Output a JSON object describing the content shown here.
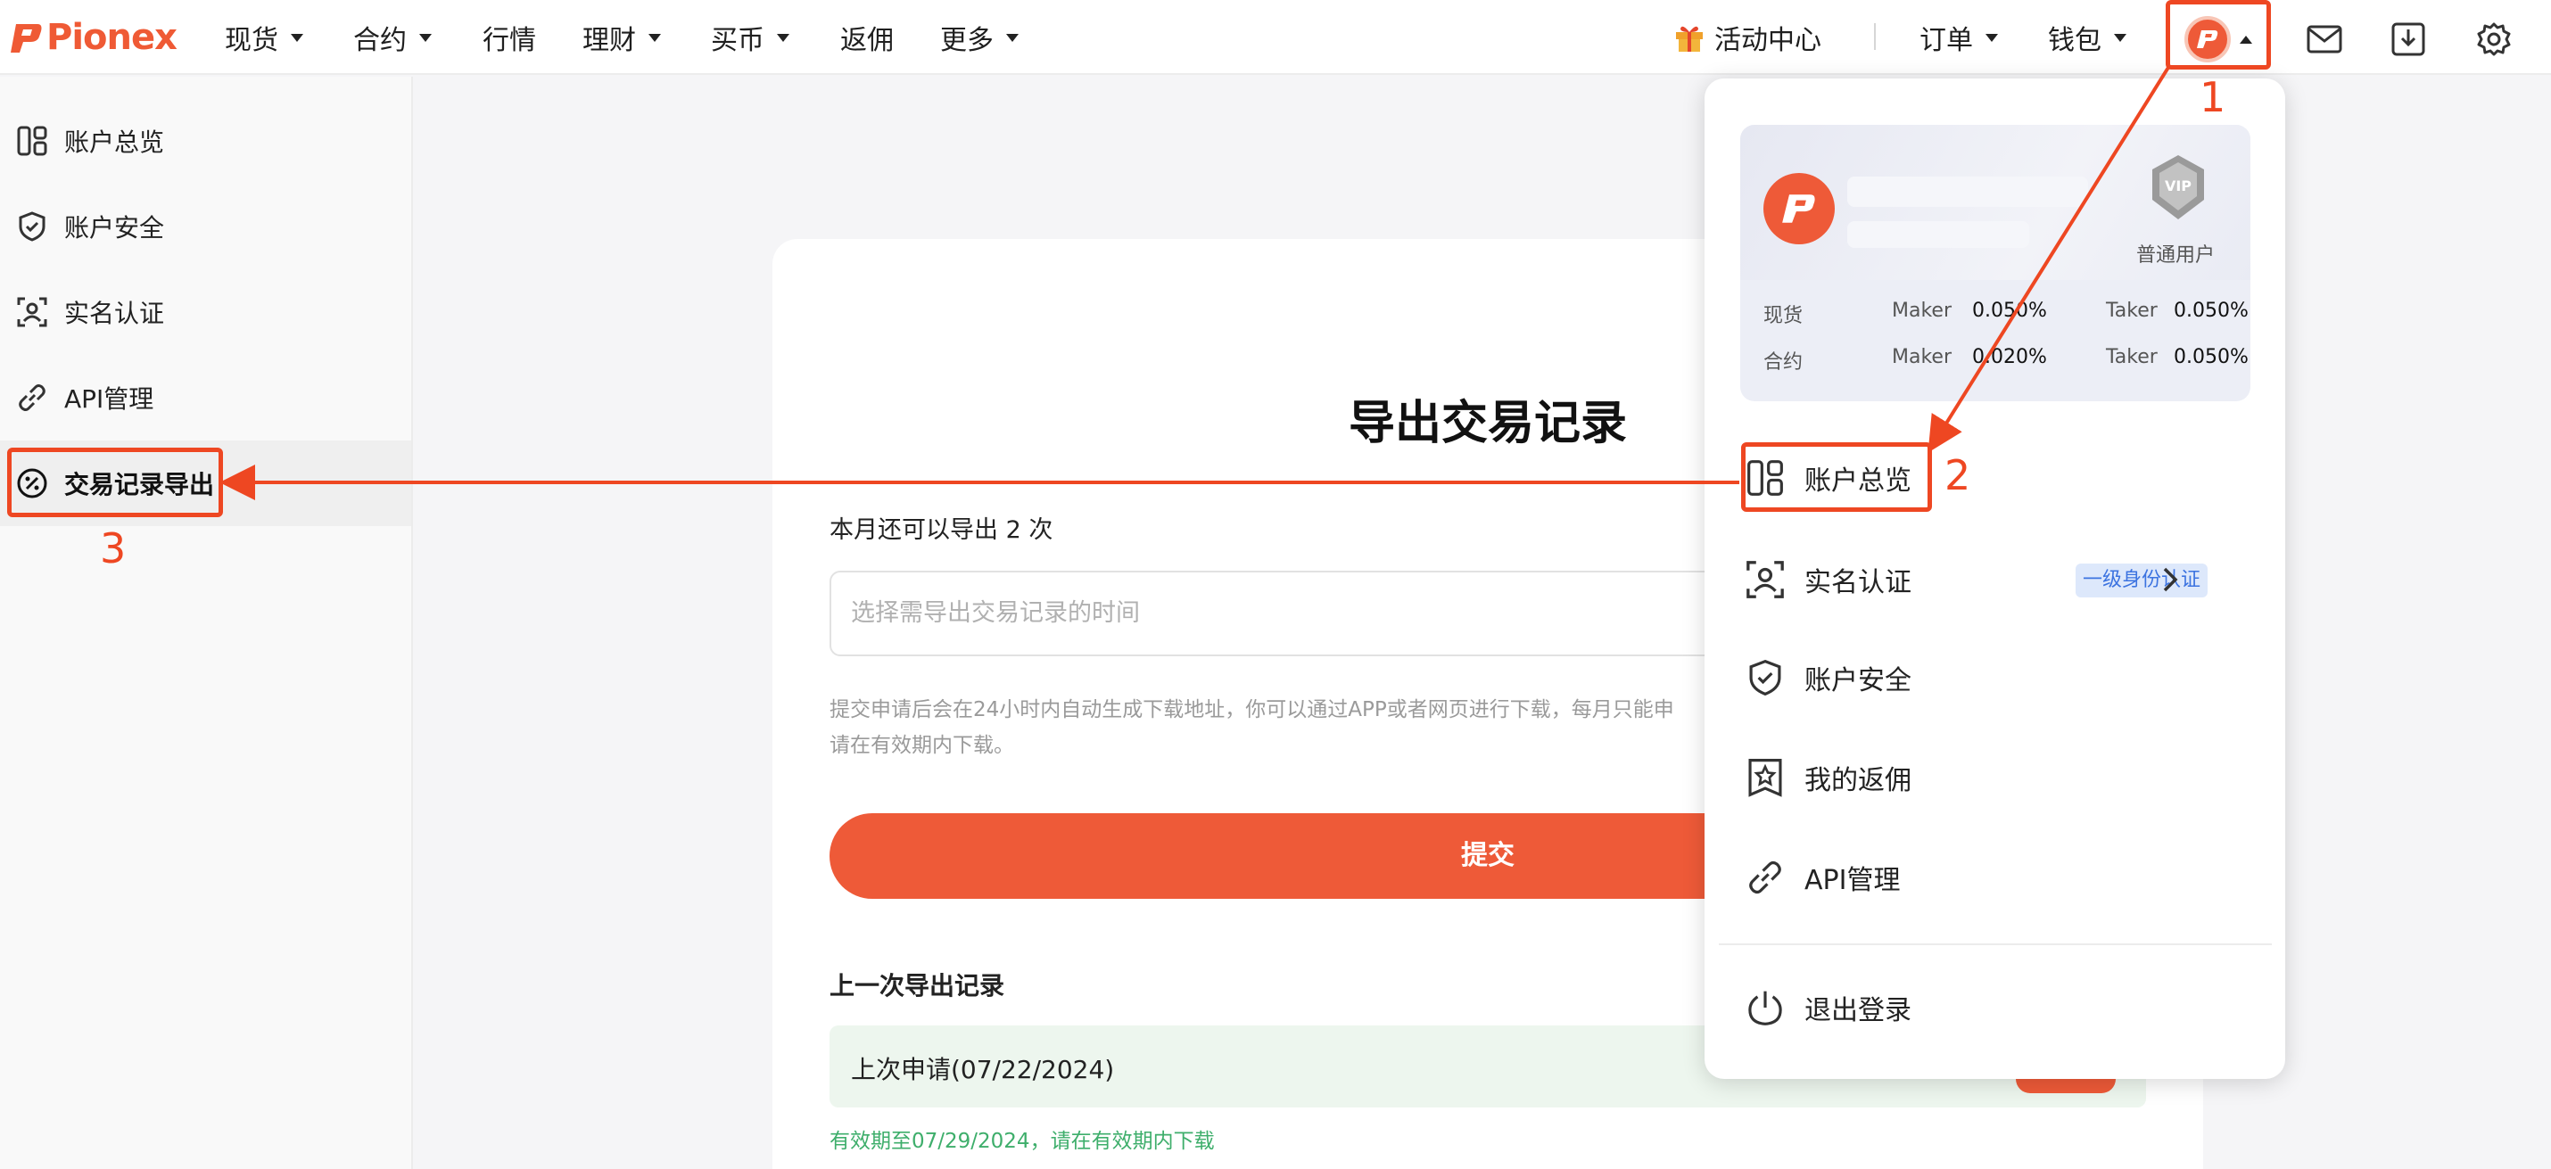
{
  "brand": {
    "name": "Pionex",
    "color": "#ef5a35"
  },
  "nav": {
    "items": [
      {
        "label": "现货",
        "caret": true
      },
      {
        "label": "合约",
        "caret": true
      },
      {
        "label": "行情",
        "caret": false
      },
      {
        "label": "理财",
        "caret": true
      },
      {
        "label": "买币",
        "caret": true
      },
      {
        "label": "返佣",
        "caret": false
      },
      {
        "label": "更多",
        "caret": true
      }
    ],
    "activity_center": "活动中心",
    "orders": "订单",
    "wallet": "钱包",
    "icons": [
      "gift-icon",
      "avatar",
      "mail-icon",
      "download-icon",
      "gear-icon"
    ]
  },
  "sidebar": {
    "items": [
      {
        "label": "账户总览",
        "icon": "dashboard-icon"
      },
      {
        "label": "账户安全",
        "icon": "shield-icon"
      },
      {
        "label": "实名认证",
        "icon": "user-id-icon"
      },
      {
        "label": "API管理",
        "icon": "link-icon"
      },
      {
        "label": "交易记录导出",
        "icon": "percent-icon",
        "active": true
      }
    ]
  },
  "main": {
    "title": "导出交易记录",
    "remaining": "本月还可以导出 2 次",
    "date_placeholder": "选择需导出交易记录的时间",
    "notice_line1": "提交申请后会在24小时内自动生成下载地址，你可以通过APP或者网页进行下载，每月只能申",
    "notice_line2": "请在有效期内下载。",
    "submit_label": "提交",
    "last_export_title": "上一次导出记录",
    "last_request": "上次申请(07/22/2024)",
    "validity": "有效期至07/29/2024，请在有效期内下载"
  },
  "dropdown": {
    "vip_label": "普通用户",
    "vip_badge_text": "VIP",
    "fees": [
      {
        "market": "现货",
        "maker_label": "Maker",
        "maker": "0.050%",
        "taker_label": "Taker",
        "taker": "0.050%"
      },
      {
        "market": "合约",
        "maker_label": "Maker",
        "maker": "0.020%",
        "taker_label": "Taker",
        "taker": "0.050%"
      }
    ],
    "items": [
      {
        "label": "账户总览",
        "icon": "dashboard-icon"
      },
      {
        "label": "实名认证",
        "icon": "user-id-icon",
        "badge": "一级身份认证"
      },
      {
        "label": "账户安全",
        "icon": "shield-icon"
      },
      {
        "label": "我的返佣",
        "icon": "star-badge-icon"
      },
      {
        "label": "API管理",
        "icon": "link-icon"
      },
      {
        "label": "退出登录",
        "icon": "power-icon"
      }
    ]
  },
  "annotations": {
    "step1": "1",
    "step2": "2",
    "step3": "3",
    "color": "#ee4722"
  }
}
